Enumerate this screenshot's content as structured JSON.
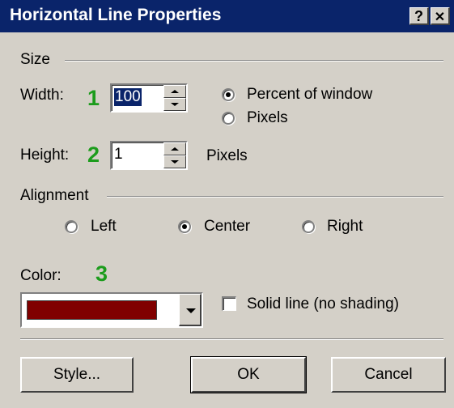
{
  "window": {
    "title": "Horizontal Line Properties",
    "help_glyph": "?",
    "close_glyph": "✕"
  },
  "size": {
    "group_label": "Size",
    "width_label": "Width:",
    "width_value": "100",
    "height_label": "Height:",
    "height_value": "1",
    "height_unit": "Pixels",
    "unit_options": [
      {
        "label": "Percent of window",
        "selected": true
      },
      {
        "label": "Pixels",
        "selected": false
      }
    ]
  },
  "alignment": {
    "group_label": "Alignment",
    "options": [
      {
        "label": "Left",
        "selected": false
      },
      {
        "label": "Center",
        "selected": true
      },
      {
        "label": "Right",
        "selected": false
      }
    ]
  },
  "color": {
    "label": "Color:",
    "value": "#800000"
  },
  "solid_line": {
    "label": "Solid line (no shading)",
    "checked": false
  },
  "callouts": [
    "1",
    "2",
    "3"
  ],
  "buttons": {
    "style": "Style...",
    "ok": "OK",
    "cancel": "Cancel"
  }
}
